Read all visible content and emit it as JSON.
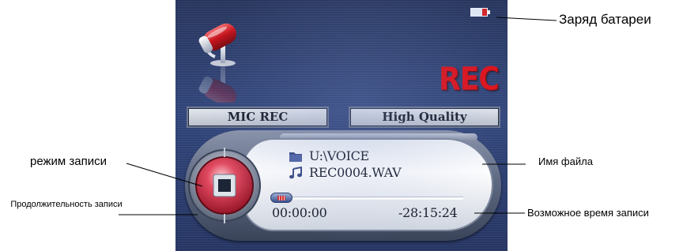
{
  "screen": {
    "badge": "REC",
    "mode_left": "MIC REC",
    "mode_right": "High Quality",
    "folder": "U:\\VOICE",
    "file": "REC0004.WAV",
    "time_elapsed": "00:00:00",
    "time_remaining": "-28:15:24",
    "progress_fraction": 0.0,
    "icons": [
      "battery-icon",
      "microphone-icon",
      "record-stop-button",
      "folder-icon",
      "music-note-icon"
    ],
    "colors": {
      "screen_bg": "#2c3d6e",
      "rec_red": "#e01018",
      "battery_low": "#d3282a"
    }
  },
  "annotations": {
    "battery": "Заряд батареи",
    "mode": "режим записи",
    "duration": "Продолжительность записи",
    "filename": "Имя файла",
    "remaining": "Возможное время записи"
  }
}
